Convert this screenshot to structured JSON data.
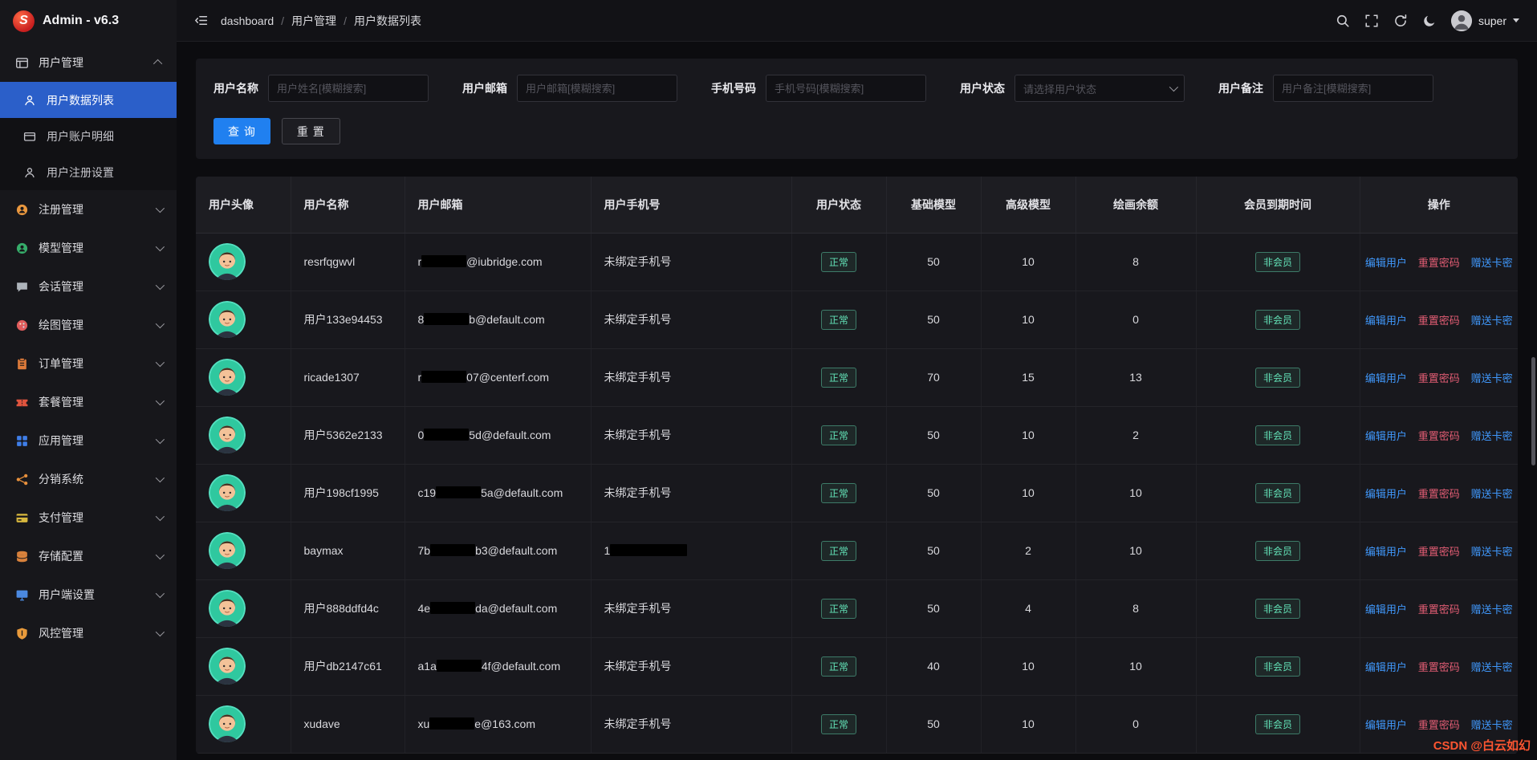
{
  "app": {
    "logo_text": "S",
    "title": "Admin - v6.3"
  },
  "colors": {
    "primary": "#2080f0",
    "success": "#63e2b7",
    "link_blue": "#4098fc",
    "danger_red": "#e25d74",
    "sidebar_active": "#2b5fc9",
    "watermark_red": "#fc5531"
  },
  "topbar": {
    "breadcrumb": [
      "dashboard",
      "用户管理",
      "用户数据列表"
    ],
    "tools": [
      {
        "name": "search-icon"
      },
      {
        "name": "fullscreen-icon"
      },
      {
        "name": "refresh-icon"
      },
      {
        "name": "moon-icon"
      }
    ],
    "username": "super"
  },
  "sidebar": {
    "items": [
      {
        "label": "用户管理",
        "icon": "panel-icon",
        "icon_color": "#c2c2c8",
        "expanded": true,
        "children": [
          {
            "label": "用户数据列表",
            "icon": "user-icon",
            "active": true
          },
          {
            "label": "用户账户明细",
            "icon": "card-icon",
            "active": false
          },
          {
            "label": "用户注册设置",
            "icon": "user-icon",
            "active": false
          }
        ]
      },
      {
        "label": "注册管理",
        "icon": "circle-icon",
        "icon_color": "#e9973e"
      },
      {
        "label": "模型管理",
        "icon": "circle-icon",
        "icon_color": "#36ad6a"
      },
      {
        "label": "会话管理",
        "icon": "bubble-icon",
        "icon_color": "#aeb4bb"
      },
      {
        "label": "绘图管理",
        "icon": "palette-icon",
        "icon_color": "#e05c5c"
      },
      {
        "label": "订单管理",
        "icon": "clipboard-icon",
        "icon_color": "#de7b3a"
      },
      {
        "label": "套餐管理",
        "icon": "ticket-icon",
        "icon_color": "#df543e"
      },
      {
        "label": "应用管理",
        "icon": "grid-icon",
        "icon_color": "#3f7ee8"
      },
      {
        "label": "分销系统",
        "icon": "share-icon",
        "icon_color": "#e8903c"
      },
      {
        "label": "支付管理",
        "icon": "paycard-icon",
        "icon_color": "#d8b83e"
      },
      {
        "label": "存储配置",
        "icon": "db-icon",
        "icon_color": "#d9823c"
      },
      {
        "label": "用户端设置",
        "icon": "monitor-icon",
        "icon_color": "#4b89e0"
      },
      {
        "label": "风控管理",
        "icon": "shield-icon",
        "icon_color": "#e89a3b"
      }
    ]
  },
  "filters": {
    "fields": [
      {
        "label": "用户名称",
        "type": "input",
        "placeholder": "用户姓名[模糊搜索]"
      },
      {
        "label": "用户邮箱",
        "type": "input",
        "placeholder": "用户邮箱[模糊搜索]"
      },
      {
        "label": "手机号码",
        "type": "input",
        "placeholder": "手机号码[模糊搜索]"
      },
      {
        "label": "用户状态",
        "type": "select",
        "placeholder": "请选择用户状态"
      },
      {
        "label": "用户备注",
        "type": "input",
        "placeholder": "用户备注[模糊搜索]"
      }
    ],
    "search_label": "查 询",
    "reset_label": "重 置"
  },
  "table": {
    "headers": [
      "用户头像",
      "用户名称",
      "用户邮箱",
      "用户手机号",
      "用户状态",
      "基础模型",
      "高级模型",
      "绘画余额",
      "会员到期时间",
      "操作"
    ],
    "actions": [
      "编辑用户",
      "重置密码",
      "赠送卡密"
    ],
    "no_phone_text": "未绑定手机号",
    "rows": [
      {
        "name": "resrfqgwvl",
        "email_pre": "r",
        "email_suf": "@iubridge.com",
        "phone": "未绑定手机号",
        "status": "正常",
        "base": "50",
        "adv": "10",
        "draw": "8",
        "member": "非会员"
      },
      {
        "name": "用户133e94453",
        "email_pre": "8",
        "email_suf": "b@default.com",
        "phone": "未绑定手机号",
        "status": "正常",
        "base": "50",
        "adv": "10",
        "draw": "0",
        "member": "非会员"
      },
      {
        "name": "ricade1307",
        "email_pre": "r",
        "email_suf": "07@centerf.com",
        "phone": "未绑定手机号",
        "status": "正常",
        "base": "70",
        "adv": "15",
        "draw": "13",
        "member": "非会员"
      },
      {
        "name": "用户5362e2133",
        "email_pre": "0",
        "email_suf": "5d@default.com",
        "phone": "未绑定手机号",
        "status": "正常",
        "base": "50",
        "adv": "10",
        "draw": "2",
        "member": "非会员"
      },
      {
        "name": "用户198cf1995",
        "email_pre": "c19",
        "email_suf": "5a@default.com",
        "phone": "未绑定手机号",
        "status": "正常",
        "base": "50",
        "adv": "10",
        "draw": "10",
        "member": "非会员"
      },
      {
        "name": "baymax",
        "email_pre": "7b",
        "email_suf": "b3@default.com",
        "phone": null,
        "phone_pre": "1",
        "status": "正常",
        "base": "50",
        "adv": "2",
        "draw": "10",
        "member": "非会员"
      },
      {
        "name": "用户888ddfd4c",
        "email_pre": "4e",
        "email_suf": "da@default.com",
        "phone": "未绑定手机号",
        "status": "正常",
        "base": "50",
        "adv": "4",
        "draw": "8",
        "member": "非会员"
      },
      {
        "name": "用户db2147c61",
        "email_pre": "a1a",
        "email_suf": "4f@default.com",
        "phone": "未绑定手机号",
        "status": "正常",
        "base": "40",
        "adv": "10",
        "draw": "10",
        "member": "非会员"
      },
      {
        "name": "xudave",
        "email_pre": "xu",
        "email_suf": "e@163.com",
        "phone": "未绑定手机号",
        "status": "正常",
        "base": "50",
        "adv": "10",
        "draw": "0",
        "member": "非会员"
      }
    ]
  },
  "watermark": "CSDN @白云如幻"
}
